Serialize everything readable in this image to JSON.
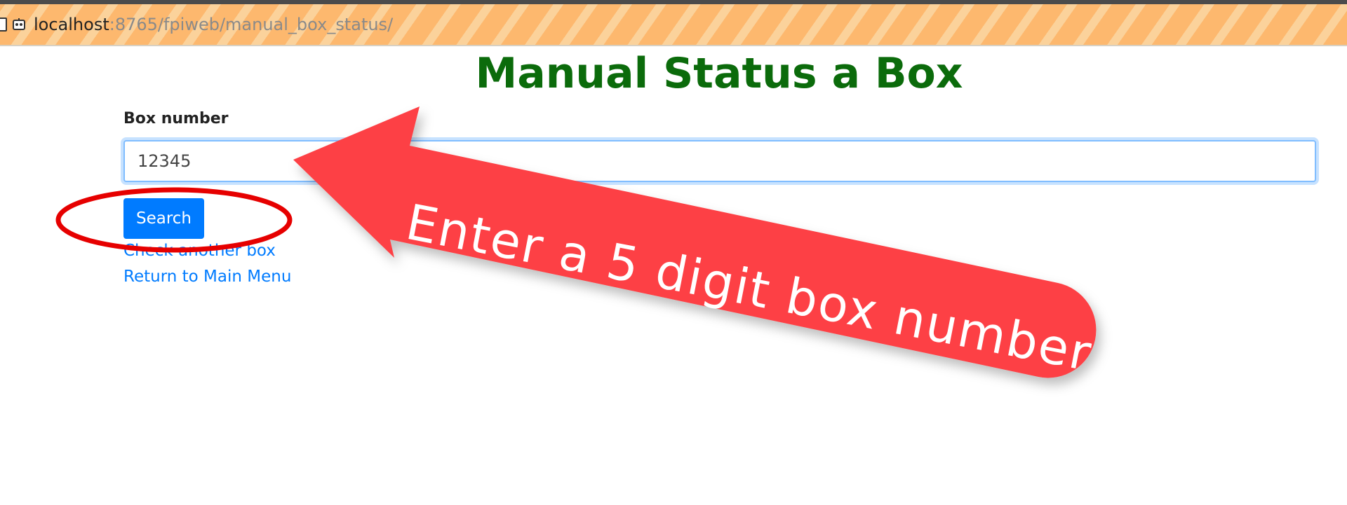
{
  "browser": {
    "url_host": "localhost",
    "url_path": ":8765/fpiweb/manual_box_status/"
  },
  "page": {
    "title": "Manual Status a Box"
  },
  "form": {
    "label": "Box number",
    "input_value": "12345",
    "search_label": "Search"
  },
  "links": {
    "check_another": "Check another box",
    "return_main": "Return to Main Menu"
  },
  "annotation": {
    "arrow_text": "Enter a 5 digit box number",
    "arrow_color": "#fd4044",
    "circle_color": "#e60000"
  },
  "colors": {
    "title": "#0b6b0b",
    "button": "#007bff",
    "link": "#007bff"
  }
}
